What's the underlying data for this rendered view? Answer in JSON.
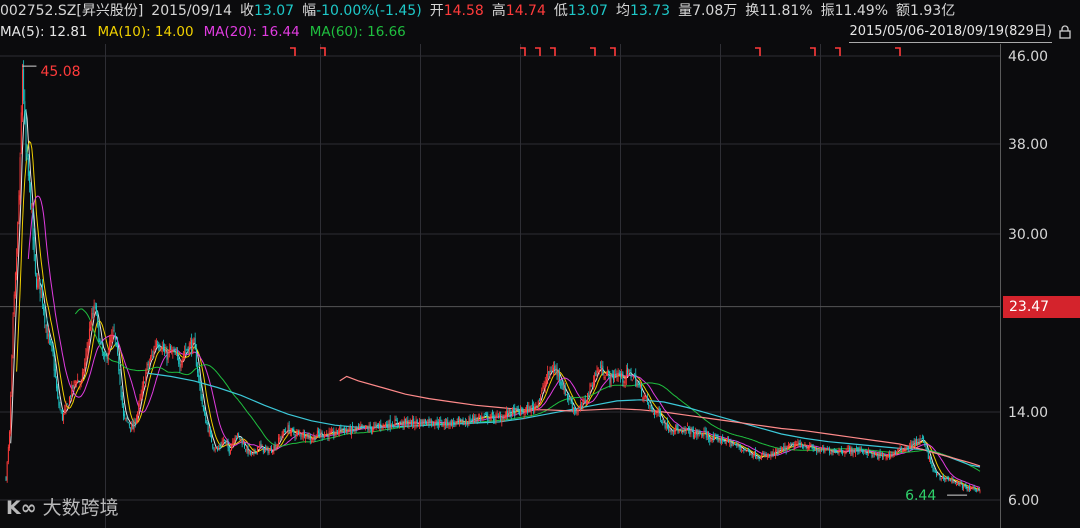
{
  "header": {
    "code": "002752.SZ[昇兴股份]",
    "date": "2015/09/14",
    "close_label": "收",
    "close": "13.07",
    "change_label": "幅",
    "change": "-10.00%(-1.45)",
    "open_label": "开",
    "open": "14.58",
    "high_label": "高",
    "high": "14.74",
    "low_label": "低",
    "low": "13.07",
    "avg_label": "均",
    "avg": "13.73",
    "vol_label": "量",
    "vol": "7.08万",
    "turn_label": "换",
    "turn": "11.81%",
    "amp_label": "振",
    "amp": "11.49%",
    "amt_label": "额",
    "amt": "1.93亿"
  },
  "ma": [
    {
      "label": "MA(5): 12.81",
      "color": "#e6e6e6"
    },
    {
      "label": "MA(10): 14.00",
      "color": "#f0d000"
    },
    {
      "label": "MA(20): 16.44",
      "color": "#e03ce0"
    },
    {
      "label": "MA(60): 16.66",
      "color": "#1fbf3f"
    }
  ],
  "range_text": "2015/05/06-2018/09/19(829日)",
  "watermark": "大数跨境",
  "colors": {
    "up": "#ff3b3b",
    "down": "#1ec8c8",
    "ma5": "#e6e6e6",
    "ma10": "#f0d000",
    "ma20": "#e03ce0",
    "ma60": "#1fbf3f",
    "ma120": "#3cc8d8",
    "ma250": "#ff8a8a",
    "grid": "#2e2e34"
  },
  "chart_data": {
    "type": "candlestick",
    "x_range": [
      "2015/05/06",
      "2018/09/19"
    ],
    "trading_days": 829,
    "y_ticks": [
      "46.00",
      "38.00",
      "30.00",
      "14.00",
      "6.00"
    ],
    "ylim": [
      6,
      46
    ],
    "max_marker": "45.08",
    "min_marker": "6.44",
    "current_price": "23.47",
    "x_gridlines": [
      0.105,
      0.32,
      0.42,
      0.52,
      0.62,
      0.72,
      0.82
    ],
    "price_anchors": [
      [
        0,
        8
      ],
      [
        3,
        12
      ],
      [
        6,
        22
      ],
      [
        9,
        28
      ],
      [
        12,
        36
      ],
      [
        14,
        45
      ],
      [
        17,
        37
      ],
      [
        21,
        33
      ],
      [
        25,
        26
      ],
      [
        30,
        25
      ],
      [
        35,
        21
      ],
      [
        40,
        19
      ],
      [
        44,
        15
      ],
      [
        48,
        13.5
      ],
      [
        52,
        14.5
      ],
      [
        56,
        16
      ],
      [
        60,
        17
      ],
      [
        64,
        16.5
      ],
      [
        68,
        19
      ],
      [
        72,
        22
      ],
      [
        76,
        23.5
      ],
      [
        80,
        20
      ],
      [
        84,
        18.5
      ],
      [
        88,
        20
      ],
      [
        92,
        21
      ],
      [
        96,
        18
      ],
      [
        100,
        13.5
      ],
      [
        104,
        13
      ],
      [
        108,
        12.5
      ],
      [
        112,
        14
      ],
      [
        116,
        16
      ],
      [
        120,
        18
      ],
      [
        124,
        19
      ],
      [
        128,
        20.5
      ],
      [
        132,
        20
      ],
      [
        136,
        19
      ],
      [
        140,
        19.5
      ],
      [
        144,
        19
      ],
      [
        148,
        18.5
      ],
      [
        152,
        19.5
      ],
      [
        156,
        20
      ],
      [
        160,
        20
      ],
      [
        164,
        17
      ],
      [
        168,
        14
      ],
      [
        172,
        12.5
      ],
      [
        176,
        11
      ],
      [
        180,
        10.5
      ],
      [
        185,
        11.5
      ],
      [
        190,
        10.5
      ],
      [
        195,
        12
      ],
      [
        200,
        11.5
      ],
      [
        205,
        10.5
      ],
      [
        210,
        10
      ],
      [
        215,
        11
      ],
      [
        220,
        10.5
      ],
      [
        225,
        10.5
      ],
      [
        230,
        11
      ],
      [
        235,
        12
      ],
      [
        240,
        12.5
      ],
      [
        245,
        12
      ],
      [
        250,
        12
      ],
      [
        255,
        12
      ],
      [
        260,
        11.5
      ],
      [
        265,
        12
      ],
      [
        270,
        12
      ],
      [
        275,
        12
      ],
      [
        280,
        12
      ],
      [
        285,
        12.5
      ],
      [
        290,
        12.3
      ],
      [
        295,
        12.3
      ],
      [
        300,
        12.5
      ],
      [
        310,
        12.5
      ],
      [
        320,
        12.8
      ],
      [
        330,
        13
      ],
      [
        340,
        13
      ],
      [
        350,
        13
      ],
      [
        360,
        13.2
      ],
      [
        370,
        13
      ],
      [
        380,
        13
      ],
      [
        390,
        13
      ],
      [
        400,
        13.5
      ],
      [
        410,
        13.5
      ],
      [
        420,
        13.5
      ],
      [
        430,
        14
      ],
      [
        440,
        14
      ],
      [
        450,
        14.5
      ],
      [
        455,
        15.5
      ],
      [
        460,
        17
      ],
      [
        465,
        18
      ],
      [
        470,
        17.5
      ],
      [
        475,
        16
      ],
      [
        480,
        15
      ],
      [
        485,
        14
      ],
      [
        490,
        14.5
      ],
      [
        495,
        15.5
      ],
      [
        500,
        17
      ],
      [
        505,
        18
      ],
      [
        510,
        17.5
      ],
      [
        515,
        17
      ],
      [
        520,
        17.5
      ],
      [
        525,
        17
      ],
      [
        530,
        17.5
      ],
      [
        535,
        17
      ],
      [
        540,
        16
      ],
      [
        545,
        15
      ],
      [
        550,
        14
      ],
      [
        555,
        14
      ],
      [
        560,
        13
      ],
      [
        565,
        12.5
      ],
      [
        570,
        12.5
      ],
      [
        575,
        12
      ],
      [
        580,
        12.5
      ],
      [
        585,
        12
      ],
      [
        590,
        12
      ],
      [
        595,
        12
      ],
      [
        600,
        11.5
      ],
      [
        610,
        11.5
      ],
      [
        620,
        11
      ],
      [
        630,
        10.5
      ],
      [
        640,
        10
      ],
      [
        650,
        10
      ],
      [
        660,
        10.5
      ],
      [
        670,
        11
      ],
      [
        680,
        11
      ],
      [
        690,
        10.5
      ],
      [
        700,
        10.5
      ],
      [
        710,
        10.5
      ],
      [
        720,
        10.5
      ],
      [
        730,
        10.5
      ],
      [
        740,
        10
      ],
      [
        750,
        10
      ],
      [
        760,
        10.5
      ],
      [
        770,
        11
      ],
      [
        780,
        11.5
      ],
      [
        785,
        10
      ],
      [
        790,
        8.5
      ],
      [
        795,
        8
      ],
      [
        800,
        8
      ],
      [
        805,
        7.8
      ],
      [
        810,
        7.5
      ],
      [
        815,
        7.2
      ],
      [
        820,
        7
      ],
      [
        825,
        7
      ],
      [
        829,
        7
      ]
    ],
    "ma250": [
      [
        284,
        16.8
      ],
      [
        290,
        17.2
      ],
      [
        300,
        16.8
      ],
      [
        320,
        16.2
      ],
      [
        340,
        15.6
      ],
      [
        360,
        15.2
      ],
      [
        380,
        14.9
      ],
      [
        400,
        14.6
      ],
      [
        420,
        14.4
      ],
      [
        440,
        14.2
      ],
      [
        460,
        14.2
      ],
      [
        480,
        14.1
      ],
      [
        500,
        14.2
      ],
      [
        520,
        14.3
      ],
      [
        540,
        14.2
      ],
      [
        560,
        14
      ],
      [
        580,
        13.7
      ],
      [
        600,
        13.4
      ],
      [
        620,
        13.1
      ],
      [
        640,
        12.8
      ],
      [
        660,
        12.5
      ],
      [
        680,
        12.3
      ],
      [
        700,
        12
      ],
      [
        720,
        11.7
      ],
      [
        740,
        11.4
      ],
      [
        760,
        11.1
      ],
      [
        780,
        10.6
      ],
      [
        800,
        10
      ],
      [
        820,
        9.4
      ],
      [
        829,
        9.1
      ]
    ],
    "ma120": [
      [
        120,
        17.5
      ],
      [
        140,
        17.2
      ],
      [
        160,
        16.8
      ],
      [
        180,
        16.2
      ],
      [
        200,
        15.5
      ],
      [
        220,
        14.6
      ],
      [
        240,
        13.8
      ],
      [
        260,
        13.2
      ],
      [
        280,
        12.8
      ],
      [
        300,
        12.6
      ],
      [
        320,
        12.6
      ],
      [
        340,
        12.7
      ],
      [
        360,
        12.8
      ],
      [
        380,
        12.9
      ],
      [
        400,
        13
      ],
      [
        420,
        13.1
      ],
      [
        440,
        13.4
      ],
      [
        460,
        13.8
      ],
      [
        480,
        14.2
      ],
      [
        500,
        14.6
      ],
      [
        520,
        15
      ],
      [
        540,
        15.1
      ],
      [
        560,
        14.9
      ],
      [
        580,
        14.4
      ],
      [
        600,
        13.8
      ],
      [
        620,
        13.2
      ],
      [
        640,
        12.6
      ],
      [
        660,
        12
      ],
      [
        680,
        11.6
      ],
      [
        700,
        11.3
      ],
      [
        720,
        11.1
      ],
      [
        740,
        10.9
      ],
      [
        760,
        10.7
      ],
      [
        780,
        10.6
      ],
      [
        800,
        10
      ],
      [
        820,
        9.2
      ],
      [
        829,
        9
      ]
    ]
  }
}
